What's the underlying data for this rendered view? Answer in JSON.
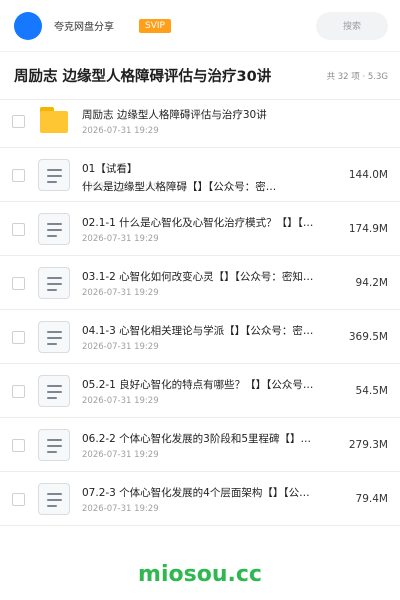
{
  "header": {
    "username": "夸克网盘分享",
    "badge": "SVIP",
    "search_placeholder": "搜索"
  },
  "folder": {
    "title": "周励志 边缘型人格障碍评估与治疗30讲",
    "meta": "共 32 项 · 5.3G"
  },
  "files": [
    {
      "type": "folder",
      "name": "周励志 边缘型人格障碍评估与治疗30讲",
      "date": "2026-07-31 19:29",
      "size": ""
    },
    {
      "type": "doc",
      "name": "01【试看】",
      "name2": "什么是边缘型人格障碍【】【公众号：密…",
      "date": "2026-07-31 19:29",
      "size": "144.0M"
    },
    {
      "type": "doc",
      "name": "02.1-1 什么是心智化及心智化治疗模式？【】【…",
      "date": "2026-07-31 19:29",
      "size": "174.9M"
    },
    {
      "type": "doc",
      "name": "03.1-2 心智化如何改变心灵【】【公众号：密知…",
      "date": "2026-07-31 19:29",
      "size": "94.2M"
    },
    {
      "type": "doc",
      "name": "04.1-3 心智化相关理论与学派【】【公众号：密…",
      "date": "2026-07-31 19:29",
      "size": "369.5M"
    },
    {
      "type": "doc",
      "name": "05.2-1 良好心智化的特点有哪些？【】【公众号…",
      "date": "2026-07-31 19:29",
      "size": "54.5M"
    },
    {
      "type": "doc",
      "name": "06.2-2 个体心智化发展的3阶段和5里程碑【】…",
      "date": "2026-07-31 19:29",
      "size": "279.3M"
    },
    {
      "type": "doc",
      "name": "07.2-3 个体心智化发展的4个层面架构【】【公…",
      "date": "2026-07-31 19:29",
      "size": "79.4M"
    }
  ],
  "watermark": "miosou.cc",
  "colors": {
    "accent": "#1677ff",
    "badge": "#ff9f1a",
    "folder": "#ffc633",
    "watermark": "#2fb84f"
  }
}
